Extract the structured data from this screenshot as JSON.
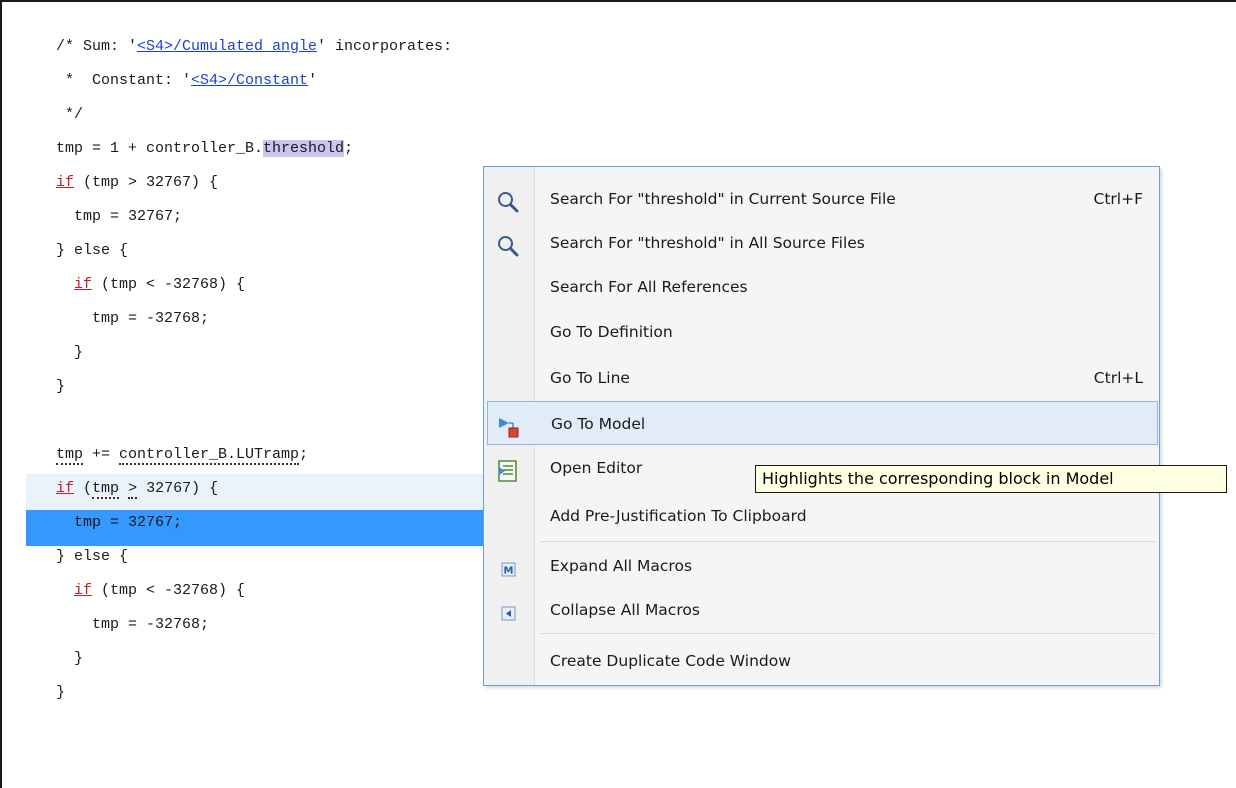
{
  "code": {
    "line1_pre": "/* Sum: '",
    "line1_link": "<S4>/Cumulated angle",
    "line1_post": "' incorporates:",
    "line2_pre": " *  Constant: '",
    "line2_link": "<S4>/Constant",
    "line2_post": "'",
    "line3": " */",
    "line4_pre": "tmp = 1 + controller_B.",
    "line4_sel": "threshold",
    "line4_post": ";",
    "kw_if": "if",
    "line5_post": " (tmp > 32767) {",
    "line6": "  tmp = 32767;",
    "line7": "} else {",
    "line8_pre": "  ",
    "line8_post": " (tmp < -32768) {",
    "line9": "    tmp = -32768;",
    "line10": "  }",
    "line11": "}",
    "line13_a": "tmp",
    "line13_b": " += ",
    "line13_c": "controller_B.LUTramp",
    "line13_d": ";",
    "line14_a": " (",
    "line14_b": "tmp",
    "line14_c": " ",
    "line14_d": ">",
    "line14_e": " 32767) {",
    "line15": "  tmp = 32767;",
    "line16": "} else {",
    "line17_pre": "  ",
    "line17_post": " (tmp < -32768) {",
    "line18": "    tmp = -32768;",
    "line19": "  }",
    "line20": "}"
  },
  "context_menu": {
    "items": [
      {
        "label": "Search For \"threshold\" in Current Source File",
        "shortcut": "Ctrl+F",
        "icon": "magnifier-icon"
      },
      {
        "label": "Search For \"threshold\" in All Source Files",
        "icon": "magnifier-icon"
      },
      {
        "label": "Search For All References"
      },
      {
        "label": "Go To Definition"
      },
      {
        "label": "Go To Line",
        "shortcut": "Ctrl+L"
      },
      {
        "label": "Go To Model",
        "icon": "go-to-model-icon"
      },
      {
        "label": "Open Editor",
        "icon": "open-editor-icon"
      },
      {
        "label": "Add Pre-Justification To Clipboard"
      },
      {
        "label": "Expand All Macros",
        "icon": "expand-macros-icon"
      },
      {
        "label": "Collapse All Macros",
        "icon": "collapse-macros-icon"
      },
      {
        "label": "Create Duplicate Code Window"
      }
    ]
  },
  "tooltip": {
    "text": "Highlights the corresponding block in Model"
  },
  "colors": {
    "selection_blue": "#3399ff",
    "keyword_red": "#c0202a",
    "link_blue": "#1a3fd8",
    "menu_hover": "#e1ecf8",
    "tooltip_bg": "#ffffe1"
  }
}
